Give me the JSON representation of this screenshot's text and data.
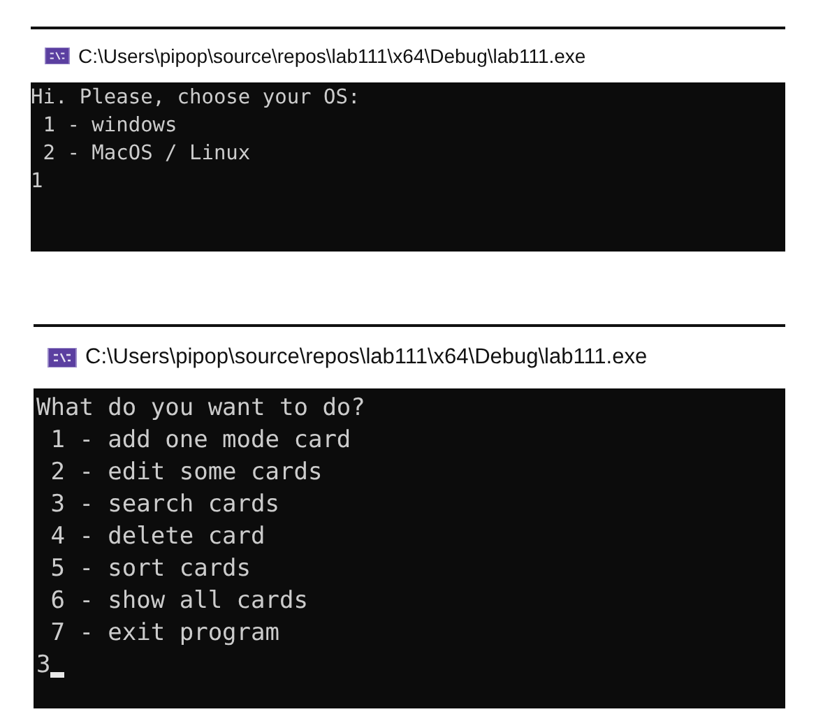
{
  "windows": [
    {
      "title": "C:\\Users\\pipop\\source\\repos\\lab111\\x64\\Debug\\lab111.exe",
      "lines": [
        "Hi. Please, choose your OS:",
        " 1 - windows",
        " 2 - MacOS / Linux",
        "1"
      ],
      "cursor": false
    },
    {
      "title": "C:\\Users\\pipop\\source\\repos\\lab111\\x64\\Debug\\lab111.exe",
      "lines": [
        "What do you want to do?",
        " 1 - add one mode card",
        " 2 - edit some cards",
        " 3 - search cards",
        " 4 - delete card",
        " 5 - sort cards",
        " 6 - show all cards",
        " 7 - exit program",
        "3"
      ],
      "cursor": true
    }
  ]
}
